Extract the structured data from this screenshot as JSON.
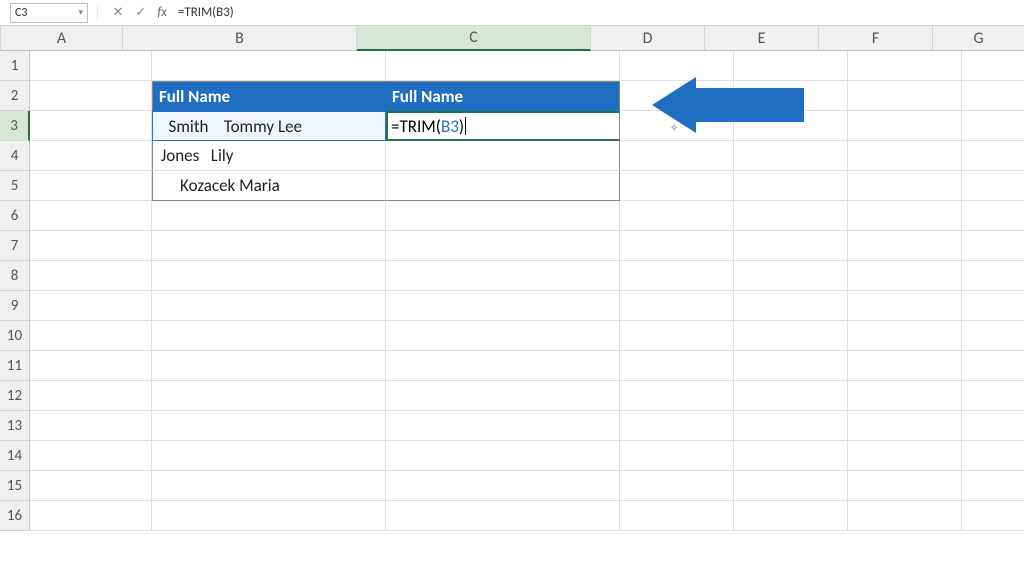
{
  "formula_bar": {
    "name_box": "C3",
    "cancel_icon": "✕",
    "enter_icon": "✓",
    "fx_label": "fx",
    "formula": "=TRIM(B3)"
  },
  "columns": [
    "A",
    "B",
    "C",
    "D",
    "E",
    "F",
    "G"
  ],
  "rows": [
    "1",
    "2",
    "3",
    "4",
    "5",
    "6",
    "7",
    "8",
    "9",
    "10",
    "11",
    "12",
    "13",
    "14",
    "15",
    "16"
  ],
  "table": {
    "header_b": "Full Name",
    "header_c": "Full Name",
    "b3": "   Smith    Tommy Lee",
    "b4": " Jones   Lily",
    "b5": "      Kozacek Maria"
  },
  "active_formula": {
    "prefix": "=TRIM(",
    "ref": "B3",
    "suffix": ")"
  }
}
